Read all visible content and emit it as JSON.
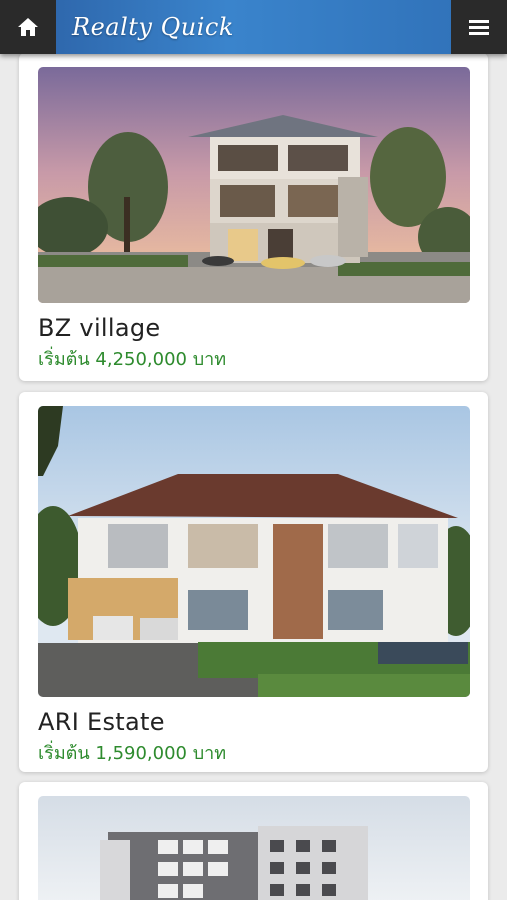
{
  "header": {
    "brand": "Realty Quick",
    "home_icon": "home-icon",
    "menu_icon": "hamburger-menu-icon",
    "brand_color": "#2f6fb6",
    "button_bg": "#2a2a2a"
  },
  "listings": [
    {
      "name": "BZ village",
      "price": "เริ่มต้น 4,250,000 บาท"
    },
    {
      "name": "ARI Estate",
      "price": "เริ่มต้น 1,590,000 บาท"
    },
    {
      "name": "",
      "price": ""
    }
  ],
  "price_color": "#2e8b2e"
}
